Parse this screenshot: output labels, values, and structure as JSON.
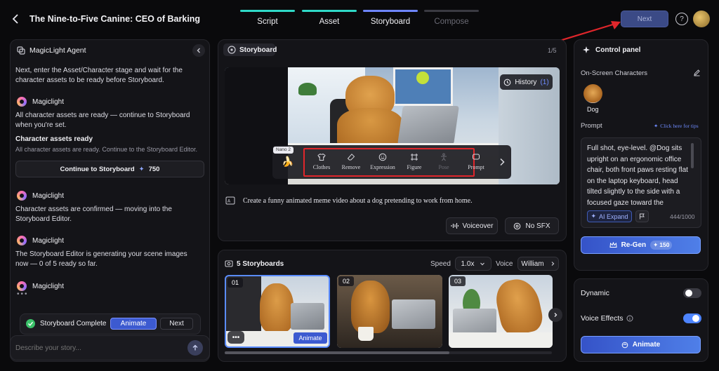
{
  "header": {
    "title": "The Nine-to-Five Canine: CEO of Barking",
    "steps": [
      {
        "label": "Script",
        "state": "done"
      },
      {
        "label": "Asset",
        "state": "done"
      },
      {
        "label": "Storyboard",
        "state": "active"
      },
      {
        "label": "Compose",
        "state": "pending"
      }
    ],
    "next_label": "Next"
  },
  "agent": {
    "title": "MagicLight Agent",
    "intro": "Next, enter the Asset/Character stage and wait for the character assets to be ready before Storyboard.",
    "messages": [
      {
        "sender": "Magiclight",
        "text": "All character assets are ready — continue to Storyboard when you're set."
      },
      {
        "sender": "Magiclight",
        "text": "Character assets are confirmed — moving into the Storyboard Editor."
      },
      {
        "sender": "Magiclight",
        "text": "The Storyboard Editor is generating your scene images now — 0 of 5 ready so far."
      },
      {
        "sender": "Magiclight",
        "text": ""
      }
    ],
    "card_title": "Character assets ready",
    "card_desc": "All character assets are ready. Continue to the Storyboard Editor.",
    "continue_label": "Continue to Storyboard",
    "continue_cost": "750",
    "complete_label": "Storyboard Complete",
    "animate_label": "Animate",
    "next_label": "Next",
    "input_placeholder": "Describe your story..."
  },
  "storyboard": {
    "title": "Storyboard",
    "page": "1/5",
    "history_label": "History",
    "history_count": "(1)",
    "badge": "Nano 2",
    "tools": [
      "Clothes",
      "Remove",
      "Expression",
      "Figure",
      "Pose",
      "Prompt"
    ],
    "description": "Create a funny animated meme video about a dog pretending to work from home.",
    "voiceover_label": "Voiceover",
    "nosfx_label": "No SFX"
  },
  "storyboards": {
    "title": "5 Storyboards",
    "speed_label": "Speed",
    "speed_value": "1.0x",
    "voice_label": "Voice",
    "voice_value": "William",
    "thumbs": [
      {
        "num": "01",
        "selected": true,
        "animate_label": "Animate"
      },
      {
        "num": "02",
        "selected": false
      },
      {
        "num": "03",
        "selected": false
      }
    ]
  },
  "control": {
    "title": "Control panel",
    "characters_label": "On-Screen Characters",
    "character_name": "Dog",
    "prompt_label": "Prompt",
    "tips_label": "Click here for tips",
    "prompt_text": "Full shot, eye-level. @Dog sits upright on an ergonomic office chair, both front paws resting flat on the laptop keyboard, head tilted slightly to the side with a focused gaze toward the",
    "ai_expand_label": "AI Expand",
    "char_count": "444/1000",
    "regen_label": "Re-Gen",
    "regen_cost": "150",
    "dynamic_label": "Dynamic",
    "dynamic_on": false,
    "voice_effects_label": "Voice Effects",
    "voice_effects_on": true,
    "animate_label": "Animate"
  },
  "colors": {
    "accent": "#5a8cff",
    "step_done": "#2fd9c8",
    "step_active": "#6e86ff",
    "annotation": "#e0262b"
  }
}
